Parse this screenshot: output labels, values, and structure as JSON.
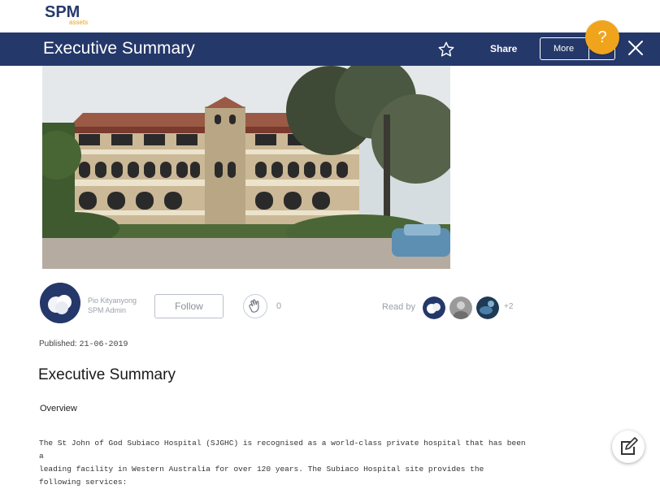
{
  "brand": {
    "logo_text": "SPM",
    "logo_sub": "assets"
  },
  "header": {
    "title": "Executive Summary",
    "share_label": "Share",
    "more_label": "More",
    "help_label": "?"
  },
  "author": {
    "name": "Pio Kityanyong",
    "role": "SPM Admin",
    "follow_label": "Follow",
    "clap_count": "0"
  },
  "readers": {
    "label": "Read by",
    "more": "+2"
  },
  "published": {
    "label": "Published:",
    "date": "21-06-2019"
  },
  "article": {
    "title": "Executive Summary",
    "section": "Overview",
    "lines": [
      "The St John of God Subiaco Hospital (SJGHC) is recognised as a world-class private hospital that has been a",
      "leading facility in Western Australia for over 120 years. The Subiaco Hospital site provides the following services:"
    ]
  },
  "colors": {
    "header_bg": "#25386a",
    "accent": "#f0a41c"
  }
}
